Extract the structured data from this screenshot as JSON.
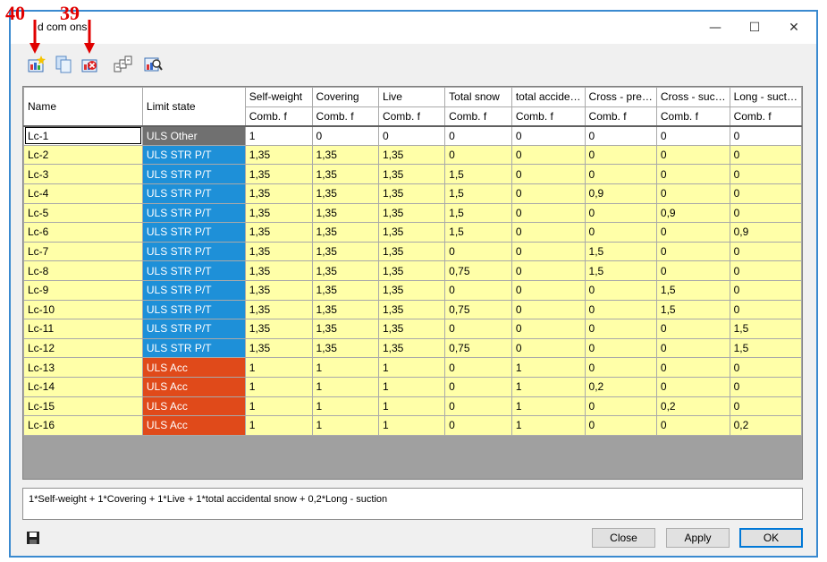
{
  "window": {
    "title": "Load combinations",
    "title_visible": "d com            ons",
    "controls": {
      "minimize": "—",
      "maximize": "☐",
      "close": "✕"
    }
  },
  "annotations": {
    "left_label": "40",
    "right_label": "39"
  },
  "toolbar": {
    "icons": [
      "new-combination-icon",
      "copy-combination-icon",
      "delete-combination-icon",
      "generate-combinations-icon",
      "inspect-combination-icon"
    ]
  },
  "table": {
    "header": {
      "name": "Name",
      "limit_state": "Limit state",
      "sub_label": "Comb. f"
    },
    "loads": [
      "Self-weight",
      "Covering",
      "Live",
      "Total snow",
      "total accide…",
      "Cross - pre…",
      "Cross - suc…",
      "Long - suct…"
    ],
    "rows": [
      {
        "name": "Lc-1",
        "ls": "ULS Other",
        "ls_color": "#707070",
        "v": [
          "1",
          "0",
          "0",
          "0",
          "0",
          "0",
          "0",
          "0"
        ]
      },
      {
        "name": "Lc-2",
        "ls": "ULS STR P/T",
        "ls_color": "#1e90d8",
        "v": [
          "1,35",
          "1,35",
          "1,35",
          "0",
          "0",
          "0",
          "0",
          "0"
        ]
      },
      {
        "name": "Lc-3",
        "ls": "ULS STR P/T",
        "ls_color": "#1e90d8",
        "v": [
          "1,35",
          "1,35",
          "1,35",
          "1,5",
          "0",
          "0",
          "0",
          "0"
        ]
      },
      {
        "name": "Lc-4",
        "ls": "ULS STR P/T",
        "ls_color": "#1e90d8",
        "v": [
          "1,35",
          "1,35",
          "1,35",
          "1,5",
          "0",
          "0,9",
          "0",
          "0"
        ]
      },
      {
        "name": "Lc-5",
        "ls": "ULS STR P/T",
        "ls_color": "#1e90d8",
        "v": [
          "1,35",
          "1,35",
          "1,35",
          "1,5",
          "0",
          "0",
          "0,9",
          "0"
        ]
      },
      {
        "name": "Lc-6",
        "ls": "ULS STR P/T",
        "ls_color": "#1e90d8",
        "v": [
          "1,35",
          "1,35",
          "1,35",
          "1,5",
          "0",
          "0",
          "0",
          "0,9"
        ]
      },
      {
        "name": "Lc-7",
        "ls": "ULS STR P/T",
        "ls_color": "#1e90d8",
        "v": [
          "1,35",
          "1,35",
          "1,35",
          "0",
          "0",
          "1,5",
          "0",
          "0"
        ]
      },
      {
        "name": "Lc-8",
        "ls": "ULS STR P/T",
        "ls_color": "#1e90d8",
        "v": [
          "1,35",
          "1,35",
          "1,35",
          "0,75",
          "0",
          "1,5",
          "0",
          "0"
        ]
      },
      {
        "name": "Lc-9",
        "ls": "ULS STR P/T",
        "ls_color": "#1e90d8",
        "v": [
          "1,35",
          "1,35",
          "1,35",
          "0",
          "0",
          "0",
          "1,5",
          "0"
        ]
      },
      {
        "name": "Lc-10",
        "ls": "ULS STR P/T",
        "ls_color": "#1e90d8",
        "v": [
          "1,35",
          "1,35",
          "1,35",
          "0,75",
          "0",
          "0",
          "1,5",
          "0"
        ]
      },
      {
        "name": "Lc-11",
        "ls": "ULS STR P/T",
        "ls_color": "#1e90d8",
        "v": [
          "1,35",
          "1,35",
          "1,35",
          "0",
          "0",
          "0",
          "0",
          "1,5"
        ]
      },
      {
        "name": "Lc-12",
        "ls": "ULS STR P/T",
        "ls_color": "#1e90d8",
        "v": [
          "1,35",
          "1,35",
          "1,35",
          "0,75",
          "0",
          "0",
          "0",
          "1,5"
        ]
      },
      {
        "name": "Lc-13",
        "ls": "ULS Acc",
        "ls_color": "#e04a1a",
        "v": [
          "1",
          "1",
          "1",
          "0",
          "1",
          "0",
          "0",
          "0"
        ]
      },
      {
        "name": "Lc-14",
        "ls": "ULS Acc",
        "ls_color": "#e04a1a",
        "v": [
          "1",
          "1",
          "1",
          "0",
          "1",
          "0,2",
          "0",
          "0"
        ]
      },
      {
        "name": "Lc-15",
        "ls": "ULS Acc",
        "ls_color": "#e04a1a",
        "v": [
          "1",
          "1",
          "1",
          "0",
          "1",
          "0",
          "0,2",
          "0"
        ]
      },
      {
        "name": "Lc-16",
        "ls": "ULS Acc",
        "ls_color": "#e04a1a",
        "v": [
          "1",
          "1",
          "1",
          "0",
          "1",
          "0",
          "0",
          "0,2"
        ]
      }
    ]
  },
  "formula": "1*Self-weight + 1*Covering + 1*Live + 1*total accidental snow + 0,2*Long - suction",
  "buttons": {
    "close": "Close",
    "apply": "Apply",
    "ok": "OK"
  }
}
